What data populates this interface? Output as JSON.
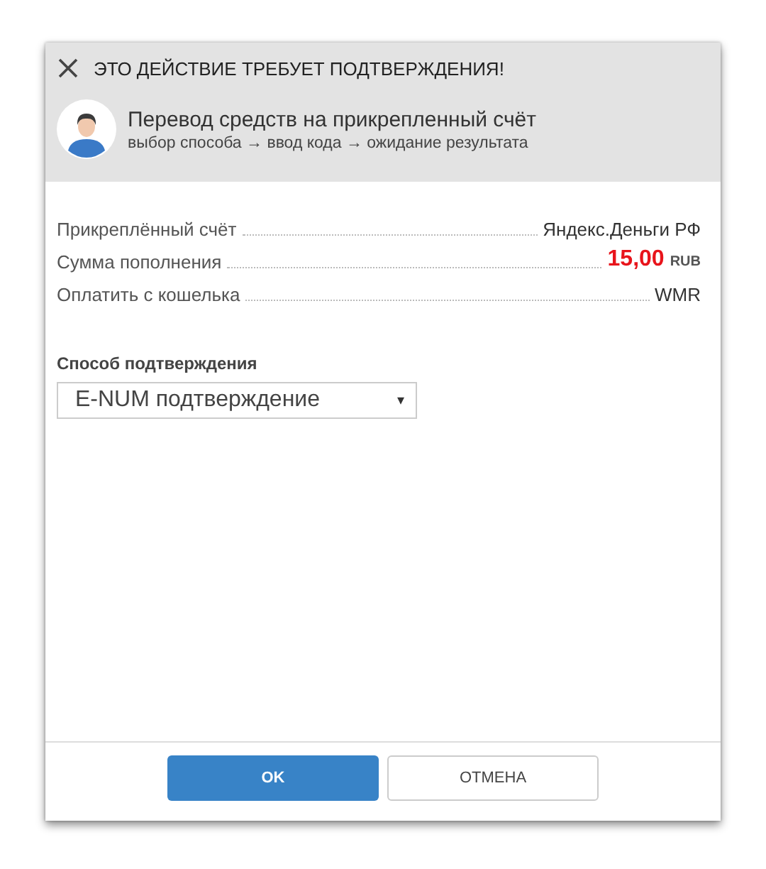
{
  "dialog": {
    "title": "ЭТО ДЕЙСТВИЕ ТРЕБУЕТ ПОДТВЕРЖДЕНИЯ!",
    "heading": "Перевод средств на прикрепленный счёт",
    "steps": "выбор способа → ввод кода → ожидание результата"
  },
  "details": [
    {
      "kind": "text",
      "label": "Прикреплённый счёт",
      "value": "Яндекс.Деньги РФ"
    },
    {
      "kind": "amount",
      "label": "Сумма пополнения",
      "amount": "15,00",
      "currency": "RUB"
    },
    {
      "kind": "text",
      "label": "Оплатить с кошелька",
      "value": "WMR"
    }
  ],
  "confirmation": {
    "label": "Способ подтверждения",
    "value": "E-NUM подтверждение",
    "caret": "▾"
  },
  "buttons": [
    {
      "kind": "primary",
      "label": "OK"
    },
    {
      "kind": "secondary",
      "label": "ОТМЕНА"
    }
  ]
}
